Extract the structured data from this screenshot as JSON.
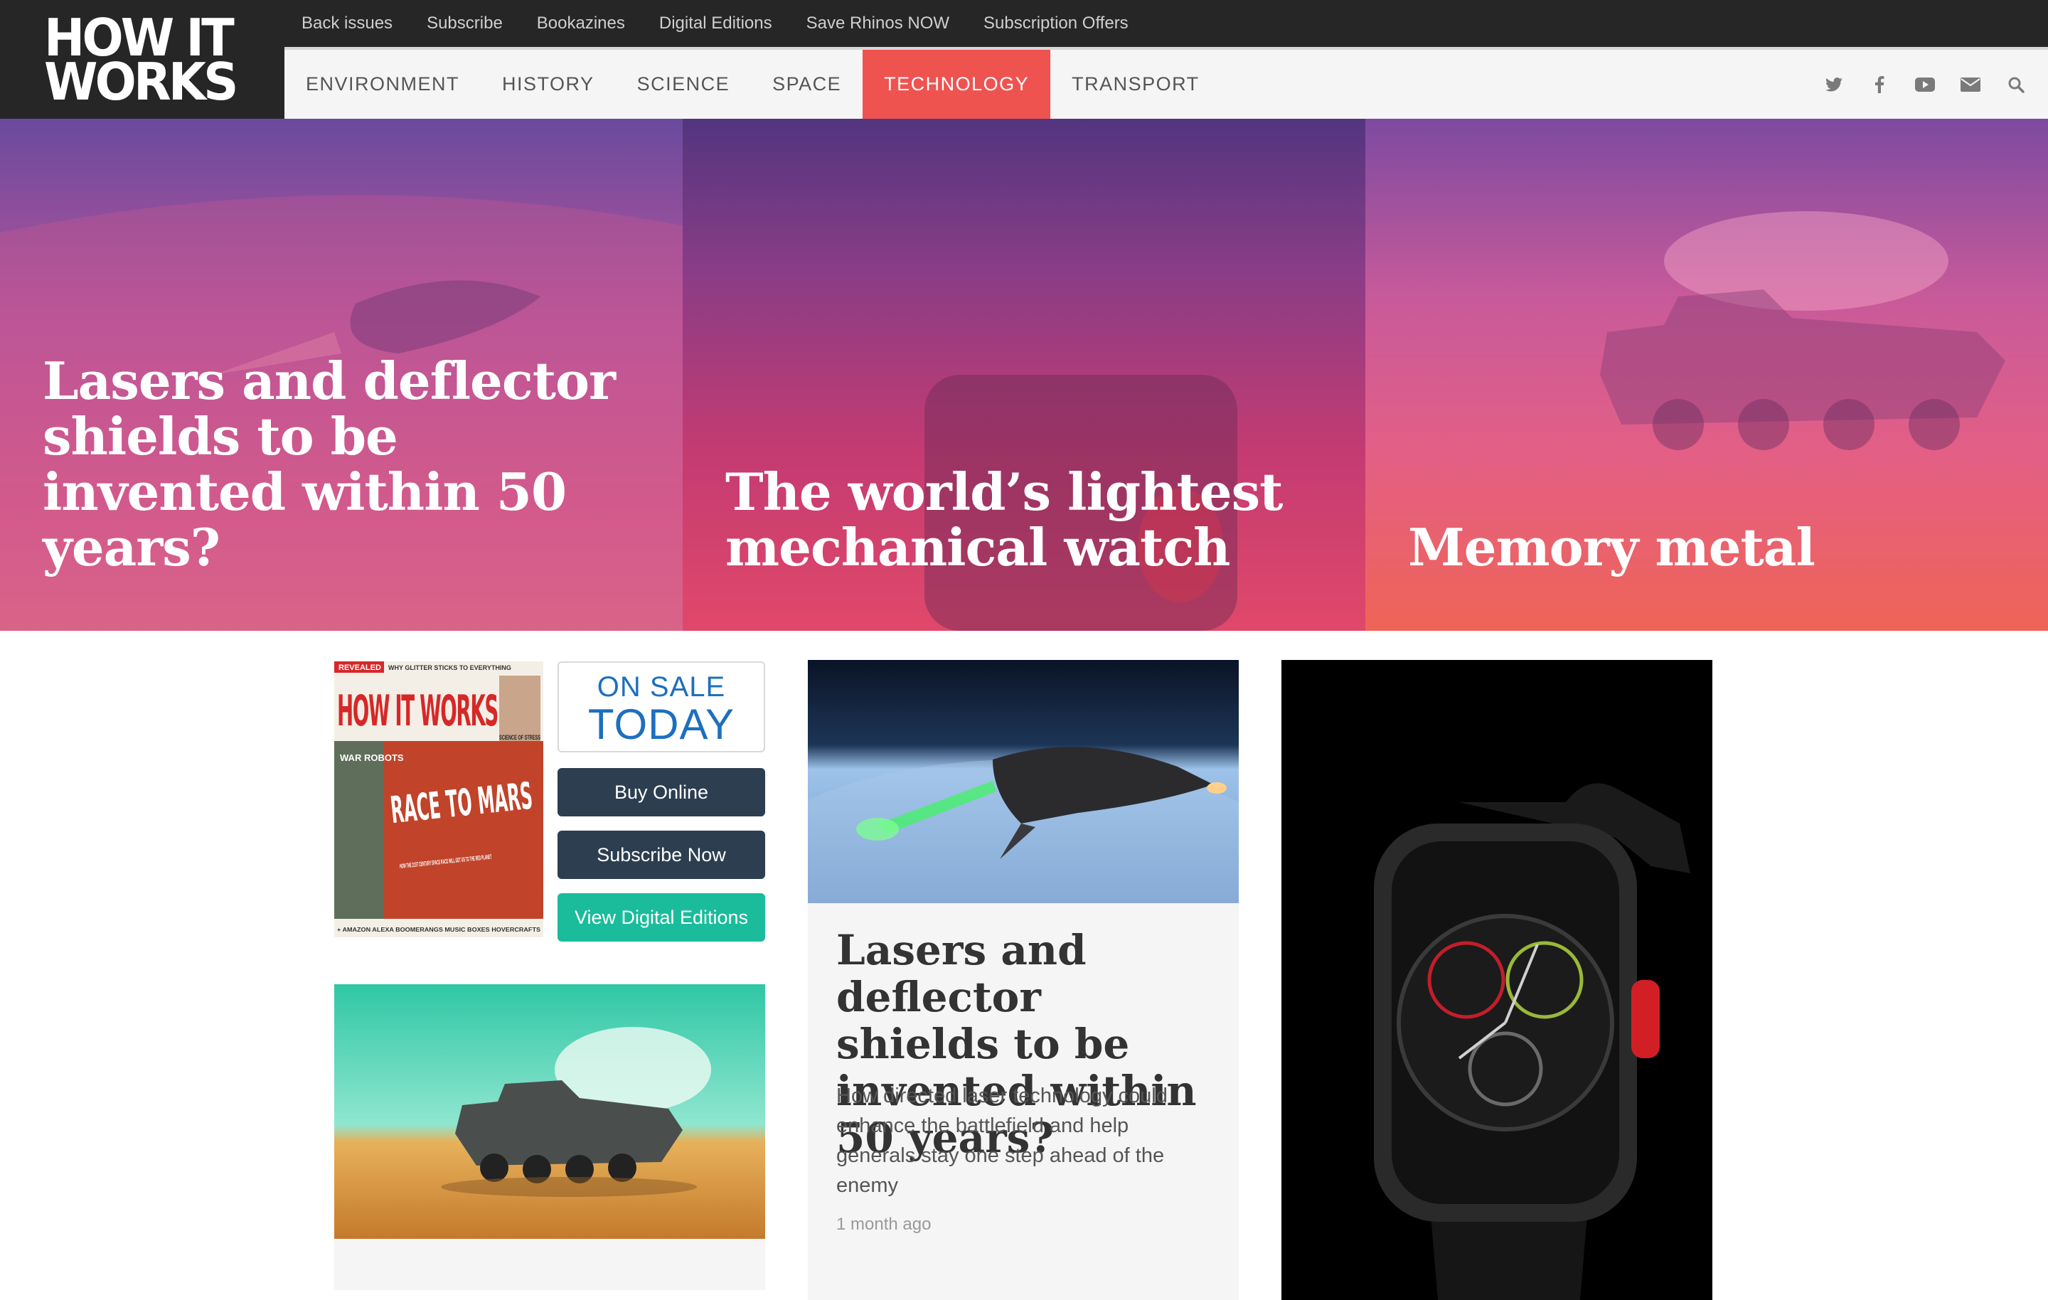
{
  "brand": {
    "logo_line1": "HOW IT",
    "logo_line2": "WORKS"
  },
  "topnav": [
    "Back issues",
    "Subscribe",
    "Bookazines",
    "Digital Editions",
    "Save Rhinos NOW",
    "Subscription Offers"
  ],
  "categories": [
    {
      "label": "ENVIRONMENT",
      "active": false
    },
    {
      "label": "HISTORY",
      "active": false
    },
    {
      "label": "SCIENCE",
      "active": false
    },
    {
      "label": "SPACE",
      "active": false
    },
    {
      "label": "TECHNOLOGY",
      "active": true
    },
    {
      "label": "TRANSPORT",
      "active": false
    }
  ],
  "social_icons": [
    "twitter-icon",
    "facebook-icon",
    "youtube-icon",
    "email-icon",
    "search-icon"
  ],
  "colors": {
    "active_tab": "#ef5350",
    "dark_button": "#2c3e50",
    "teal_button": "#1abc9c",
    "header_bg": "#262626",
    "on_sale_text": "#1d6fbf"
  },
  "hero": [
    {
      "title": "Lasers and deflector shields to be invented within 50 years?"
    },
    {
      "title": "The world’s lightest mechanical watch"
    },
    {
      "title": "Memory metal"
    }
  ],
  "promo": {
    "on_sale_line1": "ON SALE",
    "on_sale_line2": "TODAY",
    "buy_online": "Buy Online",
    "subscribe_now": "Subscribe Now",
    "view_digital": "View Digital Editions",
    "cover": {
      "masthead": "HOW IT WORKS",
      "revealed": "REVEALED",
      "tagline": "WHY GLITTER STICKS TO EVERYTHING",
      "headline": "RACE TO MARS",
      "subhead": "HOW THE 21ST CENTURY SPACE RACE WILL GET US TO THE RED PLANET",
      "side1": "WAR ROBOTS",
      "side2": "SCIENCE OF STRESS",
      "bottom": "+ AMAZON ALEXA  BOOMERANGS  MUSIC BOXES  HOVERCRAFTS"
    }
  },
  "main_card": {
    "title": "Lasers and deflector shields to be invented within 50 years?",
    "excerpt": "How directed laser technology could enhance the battlefield and help generals stay one step ahead of the enemy",
    "ago": "1 month ago"
  }
}
